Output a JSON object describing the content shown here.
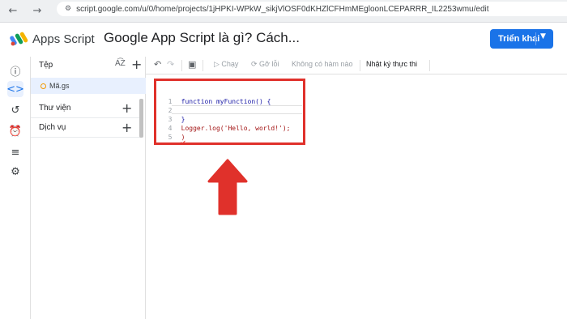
{
  "browser": {
    "url": "script.google.com/u/0/home/projects/1jHPKI-WPkW_sikjVlOSF0dKHZlCFHmMEgloonLCEPARRR_IL2253wmu/edit"
  },
  "header": {
    "app_name": "Apps Script",
    "project_title": "Google App Script là gì? Cách...",
    "deploy_label": "Triển khai"
  },
  "rail": {
    "icons": [
      "info-icon",
      "code-icon",
      "history-icon",
      "clock-icon",
      "run-list-icon",
      "settings-icon"
    ]
  },
  "files": {
    "header": "Tệp",
    "sort_label": "A͡Z",
    "items": [
      {
        "name": "Mã.gs"
      }
    ],
    "sections": [
      {
        "label": "Thư viện"
      },
      {
        "label": "Dịch vụ"
      }
    ]
  },
  "toolbar": {
    "run_label": "Chạy",
    "debug_label": "Gỡ lỗi",
    "function_label": "Không có hàm nào",
    "log_label": "Nhật ký thực thi"
  },
  "code": {
    "lines": [
      {
        "num": "1",
        "text": "function myFunction() {"
      },
      {
        "num": "2",
        "text": ""
      },
      {
        "num": "3",
        "text": "}"
      },
      {
        "num": "4",
        "text": "Logger.log('Hello, world!');"
      },
      {
        "num": "5",
        "text": ")"
      }
    ]
  },
  "colors": {
    "accent": "#1a73e8",
    "highlight_box": "#e0312b",
    "arrow": "#e0312b"
  }
}
